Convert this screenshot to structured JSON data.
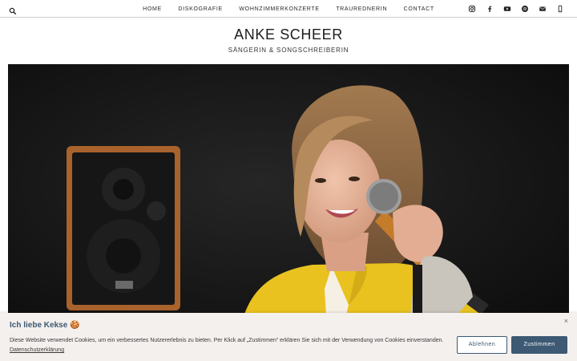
{
  "nav": {
    "items": [
      {
        "label": "HOME"
      },
      {
        "label": "DISKOGRAFIE"
      },
      {
        "label": "WOHNZIMMERKONZERTE"
      },
      {
        "label": "TRAUREDNERIN"
      },
      {
        "label": "CONTACT"
      }
    ],
    "search_icon": "search-icon",
    "social_icons": [
      "instagram-icon",
      "facebook-icon",
      "youtube-icon",
      "spotify-icon",
      "mail-icon",
      "phone-icon"
    ]
  },
  "header": {
    "title": "ANKE SCHEER",
    "tagline": "SÄNGERIN & SONGSCHREIBERIN"
  },
  "hero": {
    "image": "singer-with-microphone-photo"
  },
  "cookie_banner": {
    "title": "Ich liebe Kekse 🍪",
    "text": "Diese Website verwendet Cookies, um ein verbessertes Nutzererlebnis zu bieten. Per Klick auf „Zustimmen“ erklären Sie sich mit der Verwendung von Cookies einverstanden.",
    "privacy_link": "Datenschutzerklärung",
    "close_label": "×",
    "decline_label": "Ablehnen",
    "accept_label": "Zustimmen"
  },
  "colors": {
    "accent": "#3d5973",
    "banner_bg": "#f3f0ee",
    "hero_bg": "#151515",
    "shirt": "#e9c21f"
  }
}
